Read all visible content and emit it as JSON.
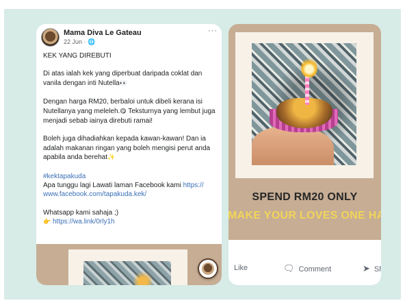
{
  "post": {
    "author": "Mama Diva Le Gateau",
    "date": "22 Jun",
    "meta_suffix": "·",
    "more": "···",
    "headline": "KEK YANG DIREBUTI",
    "p1": "Di atas ialah kek yang diperbuat daripada coklat dan vanila dengan inti Nutella",
    "p1_emoji": "👀",
    "p2a": "Dengan harga RM20, berbaloi untuk dibeli kerana isi Nutellanya yang meleleh.",
    "p2_emoji": "😋",
    "p2b": " Teksturnya yang lembut juga menjadi sebab iainya direbuti ramai!",
    "p3": "Boleh juga dihadiahkan kepada kawan-kawan! Dan ia adalah makanan ringan yang boleh mengisi perut anda apabila anda berehat",
    "p3_emoji": "✨",
    "hashtag": "#kektapakuda",
    "cta_text": "Apa tunggu lagi Lawati laman Facebook kami ",
    "fb_url": "https:// www.facebook.com/tapakuda.kek/",
    "wa_text": "Whatsapp kami sahaja ;)",
    "wa_emoji": "👉",
    "wa_url": " https://wa.link/0rly1h"
  },
  "ad": {
    "title": "SPEND RM20 ONLY",
    "subtitle": "MAKE YOUR LOVES ONE HA",
    "accent_color": "#f1d55a",
    "background_color": "#c6ad94"
  },
  "actions": {
    "like": "Like",
    "comment": "Comment",
    "share": "Sh"
  },
  "icons": {
    "comment": "comment-icon",
    "share": "share-icon",
    "globe": "globe-icon"
  }
}
